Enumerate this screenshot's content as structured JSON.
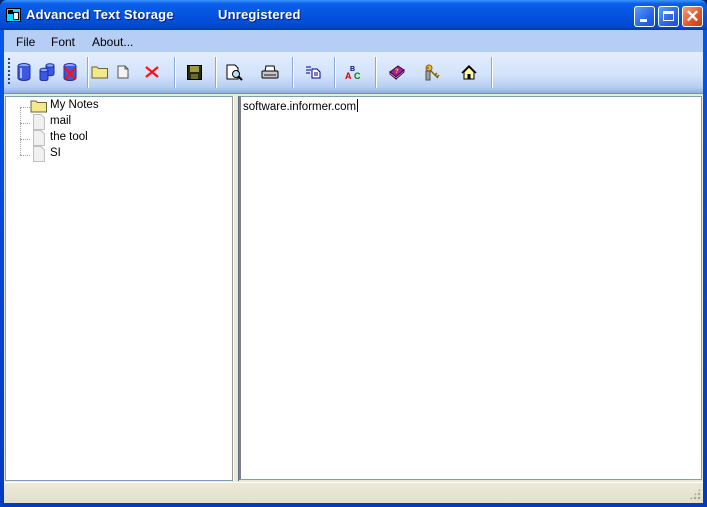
{
  "window": {
    "title": "Advanced Text Storage",
    "registration_status": "Unregistered",
    "controls": {
      "minimize": "minimize-icon",
      "maximize": "maximize-icon",
      "close": "close-icon",
      "close_glyph": "✕"
    }
  },
  "menubar": {
    "items": [
      {
        "label": "File"
      },
      {
        "label": "Font"
      },
      {
        "label": "About..."
      }
    ]
  },
  "toolbar": {
    "groups": [
      [
        {
          "icon": "database-icon",
          "name": "new-storage"
        },
        {
          "icon": "multiple-databases-icon",
          "name": "open-storage"
        },
        {
          "icon": "delete-database-icon",
          "name": "delete-storage"
        }
      ],
      [
        {
          "icon": "folder-icon",
          "name": "new-folder"
        },
        {
          "icon": "document-icon",
          "name": "new-note"
        },
        {
          "icon": "delete-x-icon",
          "name": "delete-item"
        }
      ],
      [
        {
          "icon": "floppy-disk-icon",
          "name": "save"
        }
      ],
      [
        {
          "icon": "print-preview-icon",
          "name": "print-preview"
        },
        {
          "icon": "printer-icon",
          "name": "print"
        }
      ],
      [
        {
          "icon": "copy-icon",
          "name": "copy"
        }
      ],
      [
        {
          "icon": "spell-check-icon",
          "name": "spell-check"
        }
      ],
      [
        {
          "icon": "help-book-icon",
          "name": "help"
        },
        {
          "icon": "keys-icon",
          "name": "register"
        },
        {
          "icon": "home-icon",
          "name": "homepage"
        }
      ]
    ]
  },
  "tree": {
    "root": {
      "label": "My Notes",
      "icon": "folder-icon"
    },
    "children": [
      {
        "label": "mail",
        "icon": "document-icon"
      },
      {
        "label": "the tool",
        "icon": "document-icon"
      },
      {
        "label": "SI",
        "icon": "document-icon"
      }
    ]
  },
  "editor": {
    "content": "software.informer.com"
  },
  "statusbar": {
    "text": ""
  },
  "colors": {
    "titlebar": "#0454e0",
    "menubar": "#b6cdf5",
    "toolbar": "#d3e3fb",
    "close_button": "#e35a30",
    "folder": "#f2e98a"
  }
}
